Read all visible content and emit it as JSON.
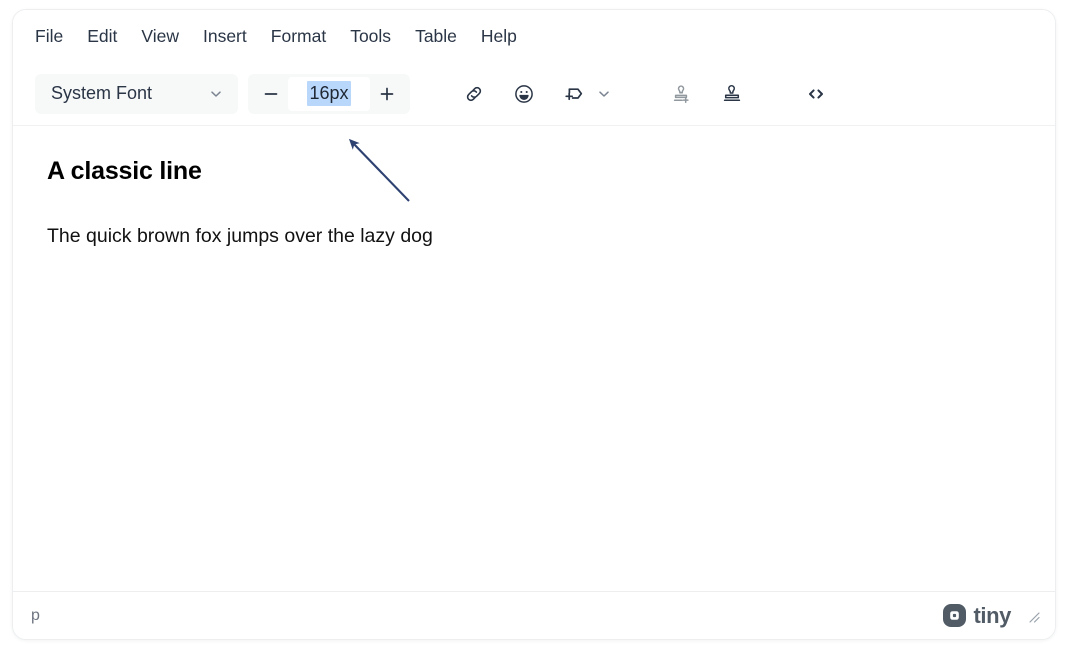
{
  "menubar": {
    "items": [
      {
        "label": "File",
        "name": "menu-file"
      },
      {
        "label": "Edit",
        "name": "menu-edit"
      },
      {
        "label": "View",
        "name": "menu-view"
      },
      {
        "label": "Insert",
        "name": "menu-insert"
      },
      {
        "label": "Format",
        "name": "menu-format"
      },
      {
        "label": "Tools",
        "name": "menu-tools"
      },
      {
        "label": "Table",
        "name": "menu-table"
      },
      {
        "label": "Help",
        "name": "menu-help"
      }
    ]
  },
  "toolbar": {
    "font_family": {
      "selected": "System Font",
      "icon": "chevron-down-icon"
    },
    "font_size": {
      "value": "16px",
      "placeholder": "16px",
      "decrease_label": "−",
      "increase_label": "+",
      "selection_highlight_color": "#b9d7fb"
    },
    "buttons": [
      {
        "name": "insert-link-button",
        "icon": "link-icon",
        "state": "enabled"
      },
      {
        "name": "emoticons-button",
        "icon": "emoji-icon",
        "state": "enabled"
      },
      {
        "name": "insert-template-button",
        "icon": "add-template-icon",
        "state": "enabled"
      },
      {
        "name": "add-stamp-button",
        "icon": "stamp-plus-icon",
        "state": "disabled"
      },
      {
        "name": "stamp-button",
        "icon": "stamp-icon",
        "state": "enabled"
      },
      {
        "name": "source-code-button",
        "icon": "code-icon",
        "state": "enabled"
      }
    ]
  },
  "content": {
    "heading": "A classic line",
    "paragraph": "The quick brown fox jumps over the lazy dog"
  },
  "statusbar": {
    "element_path": "p",
    "brand": "tiny",
    "brand_mark_icon": "tiny-logo-icon",
    "resize_icon": "resize-grip-icon"
  },
  "annotation": {
    "arrow_color": "#2e4272",
    "points_at": "font-size-input"
  },
  "colors": {
    "frame_border": "#eceef0",
    "toolbar_field_bg": "#f7f8f8",
    "text_primary": "#2a3546",
    "text_muted": "#6d7580",
    "icon_disabled": "#91999f"
  }
}
